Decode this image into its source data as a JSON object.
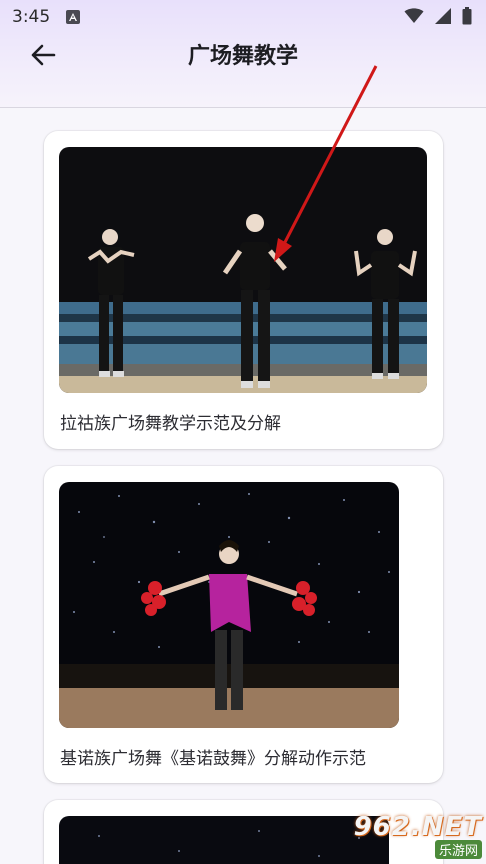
{
  "status_bar": {
    "time": "3:45"
  },
  "app_bar": {
    "title": "广场舞教学"
  },
  "videos": [
    {
      "title": "拉祜族广场舞教学示范及分解"
    },
    {
      "title": "基诺族广场舞《基诺鼓舞》分解动作示范"
    },
    {
      "title": ""
    }
  ],
  "watermark": {
    "logo": "962.NET",
    "sub": "乐游网"
  },
  "colors": {
    "header_start": "#e8e0fb",
    "background": "#f7f6fb",
    "card": "#ffffff",
    "annotation_arrow": "#d01818"
  }
}
